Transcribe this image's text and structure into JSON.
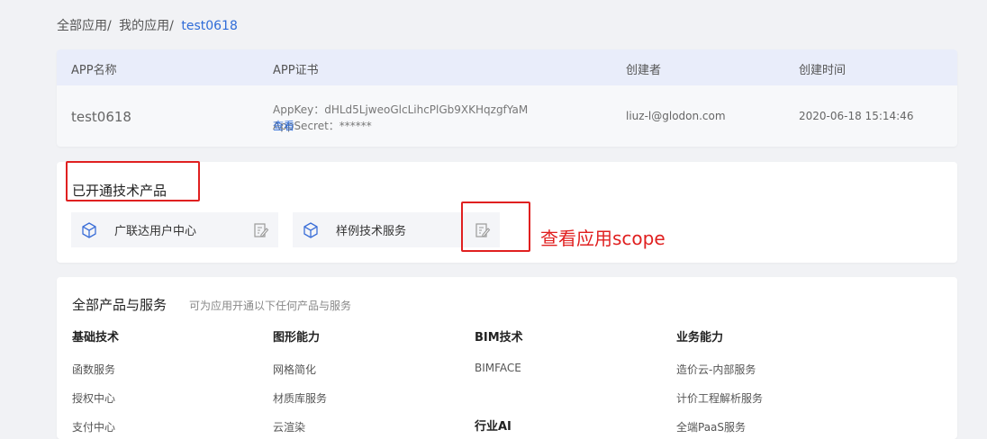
{
  "breadcrumb": {
    "items": [
      "全部应用",
      "我的应用"
    ],
    "current": "test0618"
  },
  "app_table": {
    "headers": [
      "APP名称",
      "APP证书",
      "创建者",
      "创建时间"
    ],
    "row": {
      "name": "test0618",
      "appkey_line": "AppKey：dHLd5LjweoGlcLihcPlGb9XKHqzgfYaM",
      "appsecret_line": "AppSecret：******",
      "view_label": "查看",
      "creator": "liuz-l@glodon.com",
      "created_time": "2020-06-18 15:14:46"
    }
  },
  "enabled": {
    "title": "已开通技术产品",
    "products": [
      {
        "label": "广联达用户中心",
        "icon": "cube-icon"
      },
      {
        "label": "样例技术服务",
        "icon": "cube-icon"
      }
    ]
  },
  "annotation": {
    "text": "查看应用scope",
    "color": "#e02020"
  },
  "all_products": {
    "title": "全部产品与服务",
    "subtitle": "可为应用开通以下任何产品与服务",
    "categories": [
      {
        "name": "基础技术",
        "items": [
          "函数服务",
          "授权中心",
          "支付中心"
        ]
      },
      {
        "name": "图形能力",
        "items": [
          "网格简化",
          "材质库服务",
          "云渲染"
        ]
      },
      {
        "name": "BIM技术",
        "items": [
          "BIMFACE"
        ]
      },
      {
        "name": "行业AI",
        "items": []
      },
      {
        "name": "业务能力",
        "items": [
          "造价云-内部服务",
          "计价工程解析服务",
          "全端PaaS服务"
        ]
      }
    ]
  },
  "colors": {
    "accent": "#2f6cd8",
    "header_bg": "#e9edfa",
    "highlight": "#e02020"
  }
}
